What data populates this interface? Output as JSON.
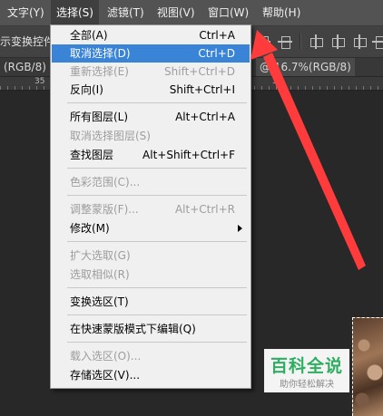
{
  "menubar": {
    "items": [
      {
        "label": "文字(Y)"
      },
      {
        "label": "选择(S)"
      },
      {
        "label": "滤镜(T)"
      },
      {
        "label": "视图(V)"
      },
      {
        "label": "窗口(W)"
      },
      {
        "label": "帮助(H)"
      }
    ]
  },
  "options_bar": {
    "label": "示变换控件"
  },
  "document_tabs": {
    "left_tab": "(RGB/8) *",
    "right_tab": "@ 16.7%(RGB/8)"
  },
  "ruler": {
    "numbers": [
      "35",
      "30"
    ]
  },
  "select_menu": {
    "items": [
      {
        "label": "全部(A)",
        "shortcut": "Ctrl+A"
      },
      {
        "label": "取消选择(D)",
        "shortcut": "Ctrl+D"
      },
      {
        "label": "重新选择(E)",
        "shortcut": "Shift+Ctrl+D"
      },
      {
        "label": "反向(I)",
        "shortcut": "Shift+Ctrl+I"
      },
      {
        "label": "所有图层(L)",
        "shortcut": "Alt+Ctrl+A"
      },
      {
        "label": "取消选择图层(S)",
        "shortcut": ""
      },
      {
        "label": "查找图层",
        "shortcut": "Alt+Shift+Ctrl+F"
      },
      {
        "label": "色彩范围(C)...",
        "shortcut": ""
      },
      {
        "label": "调整蒙版(F)...",
        "shortcut": "Alt+Ctrl+R"
      },
      {
        "label": "修改(M)",
        "shortcut": ""
      },
      {
        "label": "扩大选取(G)",
        "shortcut": ""
      },
      {
        "label": "选取相似(R)",
        "shortcut": ""
      },
      {
        "label": "变换选区(T)",
        "shortcut": ""
      },
      {
        "label": "在快速蒙版模式下编辑(Q)",
        "shortcut": ""
      },
      {
        "label": "载入选区(O)...",
        "shortcut": ""
      },
      {
        "label": "存储选区(V)...",
        "shortcut": ""
      }
    ]
  },
  "watermark": {
    "title": "百科全说",
    "subtitle": "助你轻松解决"
  },
  "colors": {
    "highlight": "#3a84d8",
    "arrow": "#ff3b3b",
    "watermark_green": "#2fae62"
  }
}
